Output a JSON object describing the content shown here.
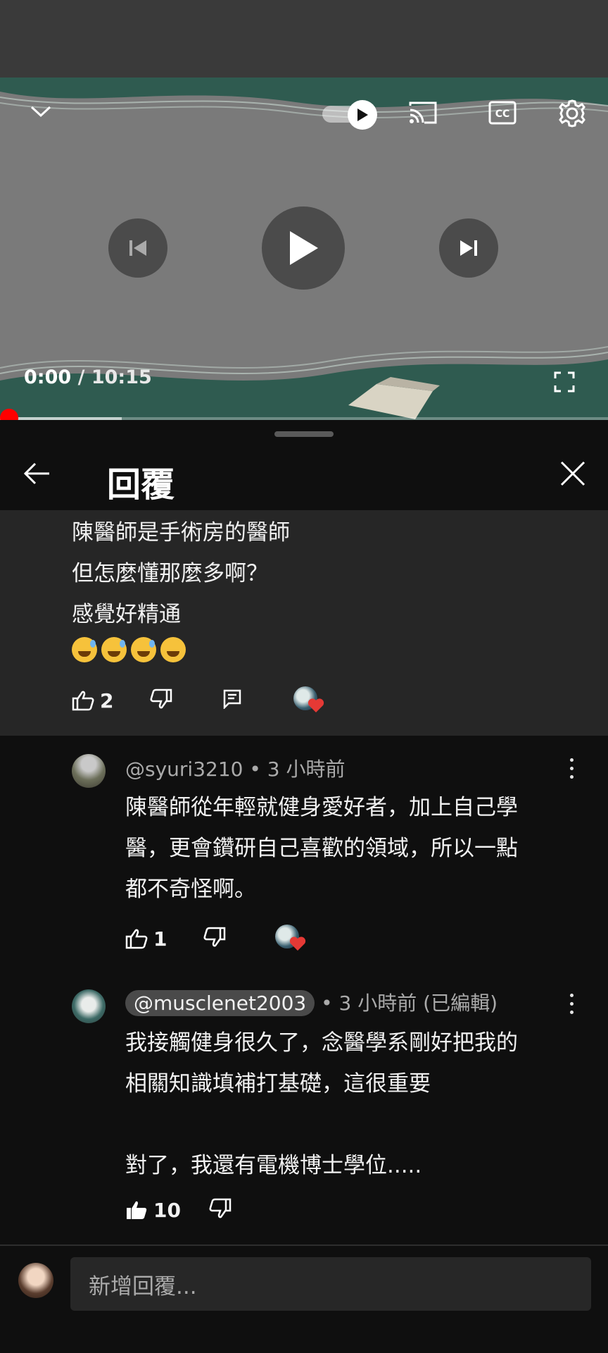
{
  "player": {
    "current_time": "0:00",
    "separator": " / ",
    "duration": "10:15",
    "progress_fraction": 0.0,
    "buffer_fraction": 0.25,
    "icons": [
      "chevron-down-icon",
      "autoplay-toggle-icon",
      "cast-icon",
      "captions-icon",
      "settings-gear-icon",
      "previous-icon",
      "play-icon",
      "next-icon",
      "fullscreen-icon"
    ]
  },
  "header": {
    "title": "回覆"
  },
  "parent_comment": {
    "lines": [
      "陳醫師是手術房的醫師",
      "但怎麼懂那麼多啊？",
      "感覺好精通"
    ],
    "emojis": "😅😅😅😊",
    "like_count": "2"
  },
  "replies": [
    {
      "handle": "@syuri3210",
      "meta": " • 3 小時前",
      "lines": [
        "陳醫師從年輕就健身愛好者，加上自己學",
        "醫，更會鑽研自己喜歡的領域，所以一點",
        "都不奇怪啊。"
      ],
      "like_count": "1"
    },
    {
      "handle": "@musclenet2003",
      "meta": " • 3 小時前 (已編輯)",
      "lines": [
        "我接觸健身很久了，念醫學系剛好把我的",
        "相關知識填補打基礎，這很重要",
        "",
        "對了，我還有電機博士學位....."
      ],
      "like_count": "10"
    }
  ],
  "composer": {
    "placeholder": "新增回覆..."
  },
  "colors": {
    "accent_red": "#ff0000",
    "heart_red": "#e53935",
    "panel_bg": "#0f0f0f",
    "parent_bg": "#262626"
  }
}
